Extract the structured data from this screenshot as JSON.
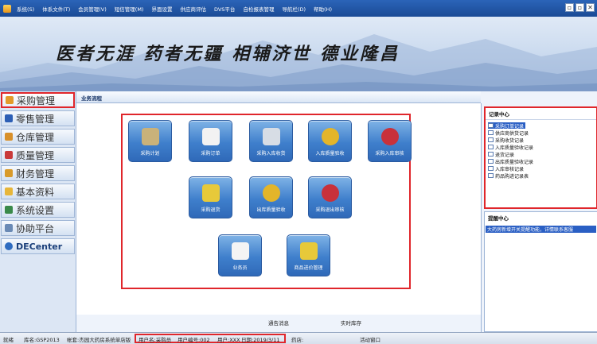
{
  "menubar": {
    "items": [
      "系统(S)",
      "体系文件(T)",
      "会员管理(V)",
      "短信管理(M)",
      "界面设置",
      "供应商评估",
      "DVS平台",
      "自检报表管理",
      "导航栏(D)",
      "帮助(H)"
    ],
    "window_buttons": [
      "▫",
      "▫",
      "✕"
    ]
  },
  "banner": {
    "slogan": "医者无涯  药者无疆  相辅济世  德业隆昌"
  },
  "sidebar": {
    "items": [
      {
        "label": "采购管理",
        "icon": "purchase-icon",
        "color": "#e39a2a"
      },
      {
        "label": "零售管理",
        "icon": "retail-icon",
        "color": "#2d5fb5"
      },
      {
        "label": "仓库管理",
        "icon": "warehouse-icon",
        "color": "#d8902a"
      },
      {
        "label": "质量管理",
        "icon": "quality-icon",
        "color": "#c93a3a"
      },
      {
        "label": "财务管理",
        "icon": "finance-icon",
        "color": "#d89a2a"
      },
      {
        "label": "基本资料",
        "icon": "basic-data-icon",
        "color": "#e7b63a"
      },
      {
        "label": "系统设置",
        "icon": "settings-icon",
        "color": "#3a8a4a"
      },
      {
        "label": "协助平台",
        "icon": "assist-icon",
        "color": "#6a8ab5"
      },
      {
        "label": "DECenter",
        "icon": "decenter-icon",
        "color": "#2f6cc0"
      }
    ]
  },
  "main": {
    "title": "业务流程",
    "buttons": [
      {
        "label": "采购计划",
        "icon": "purchase-plan-icon",
        "color": "#c9b27a"
      },
      {
        "label": "采购订单",
        "icon": "purchase-order-icon",
        "color": "#f2f2f2"
      },
      {
        "label": "采购入库收货",
        "icon": "purchase-receive-icon",
        "color": "#d7dde5"
      },
      {
        "label": "入库质量验收",
        "icon": "inbound-inspect-icon",
        "color": "#e3b52a"
      },
      {
        "label": "采购入库审核",
        "icon": "purchase-audit-icon",
        "color": "#c8313b"
      },
      {
        "label": "采购退货",
        "icon": "purchase-return-icon",
        "color": "#e7c93a"
      },
      {
        "label": "出库质量验收",
        "icon": "outbound-inspect-icon",
        "color": "#e3b52a"
      },
      {
        "label": "采购退出审核",
        "icon": "return-audit-icon",
        "color": "#c8313b"
      },
      {
        "label": "业务员",
        "icon": "salesman-icon",
        "color": "#f4f4f4"
      },
      {
        "label": "商品进价管理",
        "icon": "price-manage-icon",
        "color": "#e7c93a"
      }
    ]
  },
  "bottom": {
    "label1": "通告消息",
    "label2": "实时库存"
  },
  "right": {
    "record_title": "记录中心",
    "records": [
      "采购订单记录",
      "供应商供货记录",
      "采购收货记录",
      "入库质量验收记录",
      "退货记录",
      "出库质量验收记录",
      "入库审核记录",
      "药品购进记录表"
    ],
    "remind_title": "提醒中心",
    "remind_msg": "大药房新增开关提醒功能，详情联系客服"
  },
  "statusbar": {
    "ready": "就绪",
    "db": "库名:GSP2013",
    "account": "帐套:杰园大药房系统单店版",
    "user": "用户名:采购员",
    "user_no": "用户编号:002",
    "user_type": "用户:XXX",
    "date": "日期:2019/3/11",
    "store": "药店:",
    "window": "活动窗口"
  }
}
